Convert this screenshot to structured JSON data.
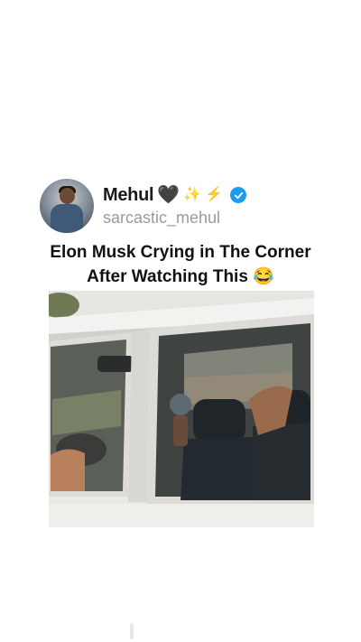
{
  "post": {
    "author": {
      "display_name": "Mehul",
      "emoji_icons": [
        "black-heart-icon",
        "sparkles-icon",
        "high-voltage-icon"
      ],
      "verified": true,
      "handle": "sarcastic_mehul"
    },
    "caption_line1": "Elon Musk Crying in The Corner",
    "caption_line2": "After Watching This 😂",
    "media": {
      "type": "video-still",
      "icon": "car-window-photo"
    }
  },
  "colors": {
    "background": "#ffffff",
    "verified_badge": "#1d9bf0",
    "handle_text": "#9a9a9a"
  }
}
